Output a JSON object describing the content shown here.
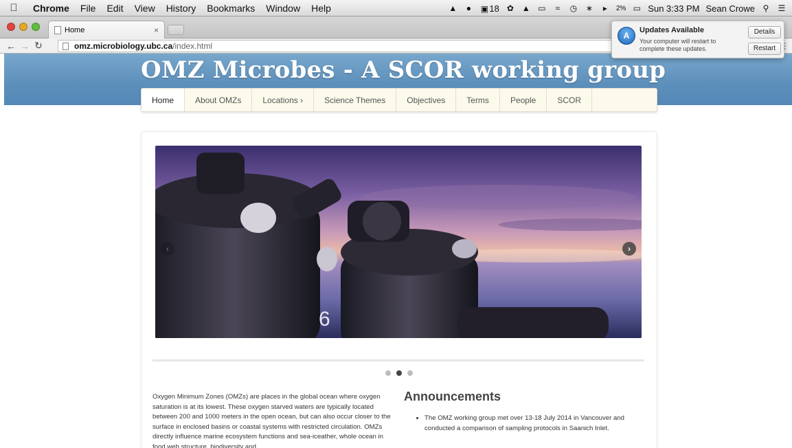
{
  "menubar": {
    "apple_icon": "apple-icon",
    "app_name": "Chrome",
    "menus": [
      "File",
      "Edit",
      "View",
      "History",
      "Bookmarks",
      "Window",
      "Help"
    ],
    "status": {
      "adobe_count": "18",
      "battery_percent": "2%",
      "clock": "Sun 3:33 PM",
      "user": "Sean Crowe"
    }
  },
  "browser": {
    "tab_title": "Home",
    "url_host": "omz.microbiology.ubc.ca",
    "url_path": "/index.html"
  },
  "notification": {
    "title": "Updates Available",
    "body": "Your computer will restart to complete these updates.",
    "details_label": "Details",
    "restart_label": "Restart"
  },
  "site": {
    "title": "OMZ Microbes - A SCOR working group",
    "nav": [
      {
        "label": "Home",
        "active": true
      },
      {
        "label": "About OMZs"
      },
      {
        "label": "Locations ›"
      },
      {
        "label": "Science Themes"
      },
      {
        "label": "Objectives"
      },
      {
        "label": "Terms"
      },
      {
        "label": "People"
      },
      {
        "label": "SCOR"
      }
    ]
  },
  "carousel": {
    "slide_count": 3,
    "active_index": 1,
    "bottle_number": "6"
  },
  "content": {
    "intro": "Oxygen Minimum Zones (OMZs) are places in the global ocean where oxygen saturation is at its lowest. These oxygen starved waters are typically located between 200 and 1000 meters in the open ocean, but can also occur closer to the surface in enclosed basins or coastal systems with restricted circulation. OMZs directly influence marine ecosystem functions and sea-iceather, whole ocean in food web structure, biodiversity and",
    "announcements_heading": "Announcements",
    "announcements": [
      "The OMZ working group met over 13-18 July 2014 in Vancouver and conducted a comparison of sampling protocols in Saanich Inlet."
    ]
  },
  "colors": {
    "header_blue": "#5d8fbb",
    "nav_bg": "#fbfaeb"
  }
}
